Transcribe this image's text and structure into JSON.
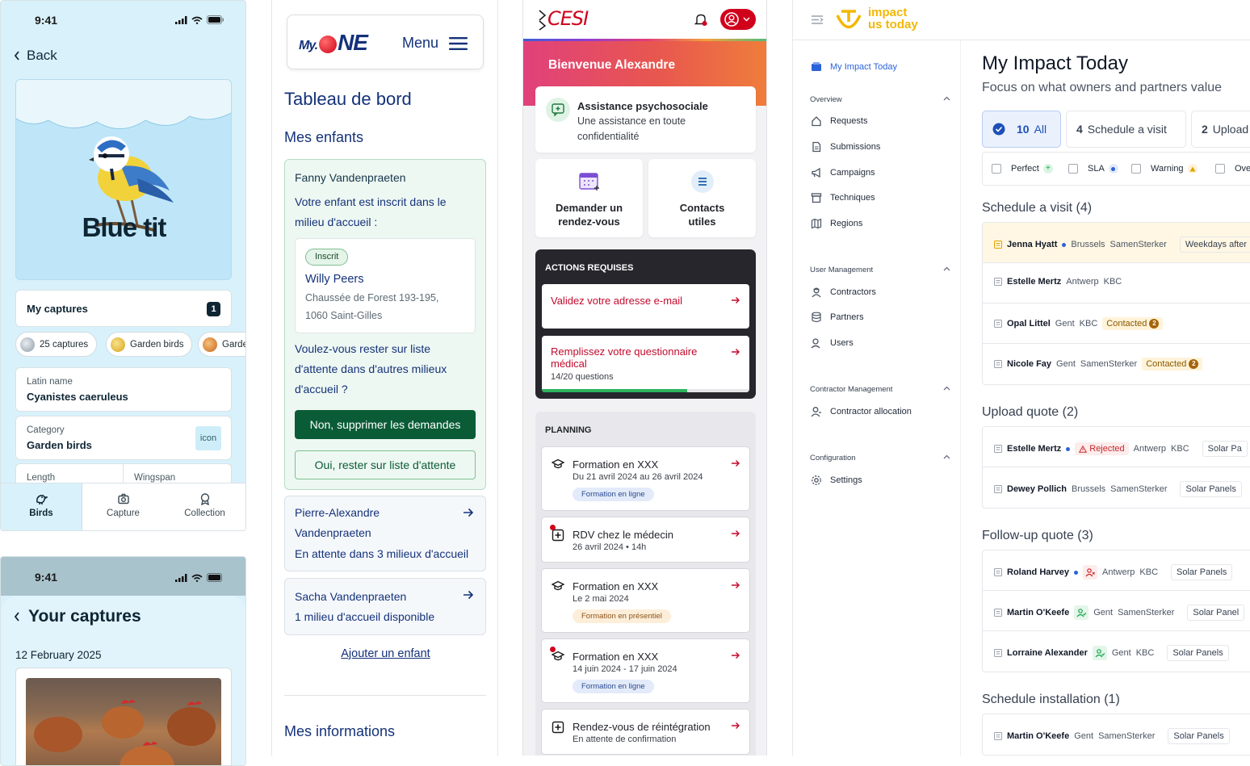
{
  "birds": {
    "status_time": "9:41",
    "back_label": "Back",
    "hero_title": "Blue tit",
    "my_captures_label": "My captures",
    "my_captures_count": "1",
    "chips": [
      "25 captures",
      "Garden birds",
      "Garde"
    ],
    "latin_name_key": "Latin name",
    "latin_name_value": "Cyanistes caeruleus",
    "category_key": "Category",
    "category_value": "Garden birds",
    "icon_placeholder": "icon",
    "length_key": "Length",
    "wingspan_key": "Wingspan",
    "tabs": [
      "Birds",
      "Capture",
      "Collection"
    ],
    "captures_screen": {
      "status_time": "9:41",
      "title": "Your captures",
      "date": "12 February 2025"
    }
  },
  "myone": {
    "logo_my": "My.",
    "logo_one": "NE",
    "menu_label": "Menu",
    "page_title": "Tableau de bord",
    "children_title": "Mes enfants",
    "fanny": {
      "name": "Fanny Vandenpraeten",
      "intro": "Votre enfant est inscrit dans le milieu d'accueil :",
      "status": "Inscrit",
      "place_name": "Willy Peers",
      "address_1": "Chaussée de Forest 193-195,",
      "address_2": "1060 Saint-Gilles",
      "question": "Voulez-vous rester sur liste d'attente dans d'autres milieux d'accueil ?",
      "btn_no": "Non, supprimer les demandes",
      "btn_yes": "Oui, rester sur liste d'attente"
    },
    "pierre": {
      "name": "Pierre-Alexandre Vandenpraeten",
      "status": "En attente dans 3 milieux d'accueil"
    },
    "sacha": {
      "name": "Sacha Vandenpraeten",
      "status": "1 milieu d'accueil disponible"
    },
    "add_child": "Ajouter un enfant",
    "info_title": "Mes informations"
  },
  "cesi": {
    "logo": "CESI",
    "welcome": "Bienvenue Alexandre",
    "assist_title": "Assistance psychosociale",
    "assist_text": "Une assistance en toute confidentialité",
    "rdv_label": "Demander un rendez-vous",
    "contacts_label": "Contacts utiles",
    "actions_title": "ACTIONS REQUISES",
    "action_email": "Validez votre adresse e-mail",
    "action_medical": "Remplissez votre questionnaire médical",
    "action_medical_progress_text": "14/20 questions",
    "action_medical_progress": 0.7,
    "planning_title": "PLANNING",
    "planning": [
      {
        "title": "Formation en XXX",
        "sub": "Du 21 avril 2024 au 26 avril 2024",
        "tag": "Formation en ligne",
        "tag_kind": "blue",
        "alert": false
      },
      {
        "title": "RDV chez le médecin",
        "sub": "26 avril 2024 • 14h",
        "tag": "",
        "tag_kind": "",
        "alert": true
      },
      {
        "title": "Formation en XXX",
        "sub": "Le 2 mai 2024",
        "tag": "Formation en présentiel",
        "tag_kind": "orange",
        "alert": false
      },
      {
        "title": "Formation en XXX",
        "sub": "14 juin 2024 - 17 juin 2024",
        "tag": "Formation en ligne",
        "tag_kind": "blue",
        "alert": true
      },
      {
        "title": "Rendez-vous de réintégration",
        "sub": "En attente de confirmation",
        "tag": "",
        "tag_kind": "",
        "alert": false
      }
    ]
  },
  "impact": {
    "logo_line1": "impact",
    "logo_line2": "us today",
    "sidebar": {
      "active": "My Impact Today",
      "overview_title": "Overview",
      "overview_items": [
        "Requests",
        "Submissions",
        "Campaigns",
        "Techniques",
        "Regions"
      ],
      "user_mgmt_title": "User Management",
      "user_mgmt_items": [
        "Contractors",
        "Partners",
        "Users"
      ],
      "contractor_mgmt_title": "Contractor Management",
      "contractor_mgmt_items": [
        "Contractor allocation"
      ],
      "config_title": "Configuration",
      "config_items": [
        "Settings"
      ]
    },
    "title": "My Impact Today",
    "subtitle": "Focus on what owners and partners value",
    "tabs": [
      {
        "count": "10",
        "label": "All"
      },
      {
        "count": "4",
        "label": "Schedule a visit"
      },
      {
        "count": "2",
        "label": "Upload"
      }
    ],
    "filters": [
      "Perfect",
      "SLA",
      "Warning",
      "Over"
    ],
    "sections": {
      "schedule_visit": "Schedule a visit (4)",
      "upload_quote": "Upload quote (2)",
      "followup_quote": "Follow-up quote (3)",
      "schedule_install": "Schedule installation (1)"
    },
    "visit_rows": [
      {
        "name": "Jenna Hyatt",
        "city": "Brussels",
        "partner": "SamenSterker",
        "extra": "Weekdays after"
      },
      {
        "name": "Estelle Mertz",
        "city": "Antwerp",
        "partner": "KBC"
      },
      {
        "name": "Opal Littel",
        "city": "Gent",
        "partner": "KBC",
        "status": "Contacted",
        "count": "2"
      },
      {
        "name": "Nicole Fay",
        "city": "Gent",
        "partner": "SamenSterker",
        "status": "Contacted",
        "count": "2"
      }
    ],
    "upload_rows": [
      {
        "name": "Estelle Mertz",
        "status": "Rejected",
        "city": "Antwerp",
        "partner": "KBC",
        "extra": "Solar Pa"
      },
      {
        "name": "Dewey Pollich",
        "city": "Brussels",
        "partner": "SamenSterker",
        "extra": "Solar Panels"
      }
    ],
    "followup_rows": [
      {
        "name": "Roland Harvey",
        "city": "Antwerp",
        "partner": "KBC",
        "extra": "Solar Panels"
      },
      {
        "name": "Martin O'Keefe",
        "city": "Gent",
        "partner": "SamenSterker",
        "extra": "Solar Panel"
      },
      {
        "name": "Lorraine Alexander",
        "city": "Gent",
        "partner": "KBC",
        "extra": "Solar Panels"
      }
    ],
    "install_rows": [
      {
        "name": "Martin O'Keefe",
        "city": "Gent",
        "partner": "SamenSterker",
        "extra": "Solar Panels"
      }
    ]
  }
}
